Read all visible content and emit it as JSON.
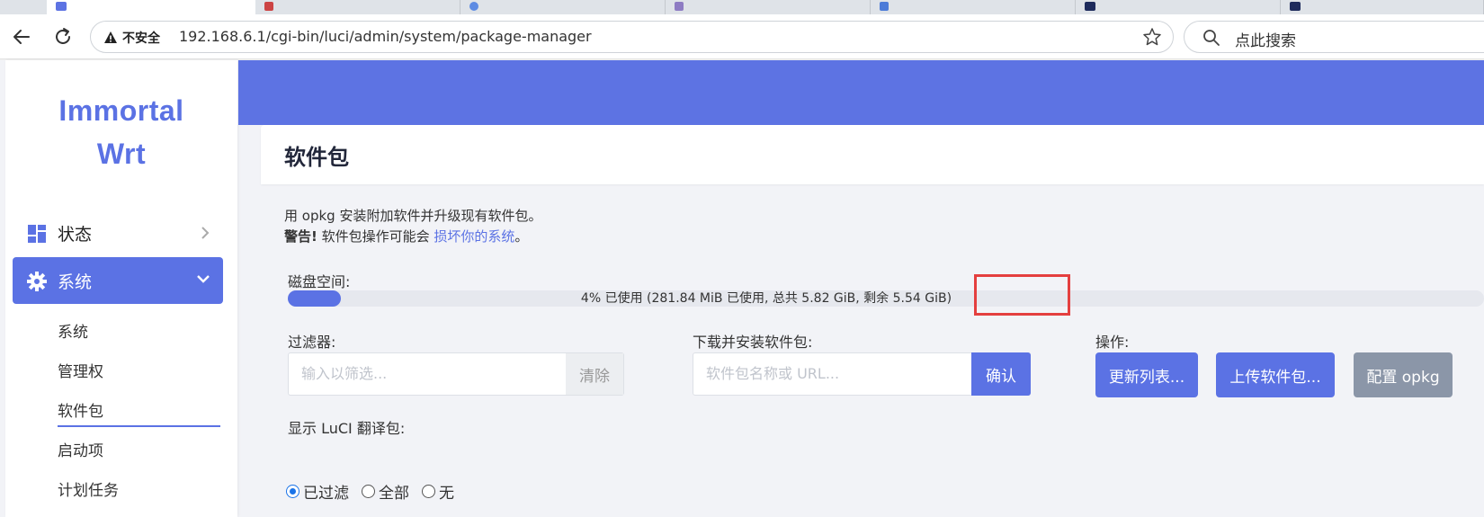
{
  "browser": {
    "not_secure_label": "不安全",
    "url": "192.168.6.1/cgi-bin/luci/admin/system/package-manager",
    "search_text": "点此搜索",
    "icons": [
      "back-icon",
      "reload-icon",
      "warning-icon",
      "star-icon",
      "search-icon"
    ]
  },
  "sidebar": {
    "brand_line1": "Immortal",
    "brand_line2": "Wrt",
    "items": [
      {
        "label": "状态",
        "icon": "dashboard-icon",
        "active": false
      },
      {
        "label": "系统",
        "icon": "gear-icon",
        "active": true
      }
    ],
    "submenu": [
      {
        "label": "系统"
      },
      {
        "label": "管理权"
      },
      {
        "label": "软件包",
        "active": true
      },
      {
        "label": "启动项"
      },
      {
        "label": "计划任务"
      }
    ]
  },
  "main": {
    "title": "软件包",
    "desc_line1": "用 opkg 安装附加软件并升级现有软件包。",
    "warning_bold": "警告!",
    "warning_text": " 软件包操作可能会 ",
    "warning_link": "损坏你的系统",
    "warning_end": "。",
    "disk_label": "磁盘空间:",
    "disk_used_percent": 4,
    "disk_text_prefix": "4% 已使用 (281.84 MiB 已使用, ",
    "disk_text_total": "总共 5.82 GiB,",
    "disk_text_suffix": " 剩余 5.54 GiB)",
    "filter_label": "过滤器:",
    "filter_placeholder": "输入以筛选...",
    "clear_label": "清除",
    "download_label": "下载并安装软件包:",
    "download_placeholder": "软件包名称或 URL...",
    "confirm_label": "确认",
    "actions_label": "操作:",
    "update_list_label": "更新列表...",
    "upload_label": "上传软件包...",
    "config_label": "配置 opkg",
    "luci_translation_label": "显示 LuCI 翻译包:",
    "radio_options": [
      {
        "label": "已过滤",
        "checked": true
      },
      {
        "label": "全部",
        "checked": false
      },
      {
        "label": "无",
        "checked": false
      }
    ]
  },
  "colors": {
    "accent": "#5b72e4",
    "banner": "#5d73e3",
    "highlight": "#e43f3f",
    "config_button": "#8b96a8"
  }
}
